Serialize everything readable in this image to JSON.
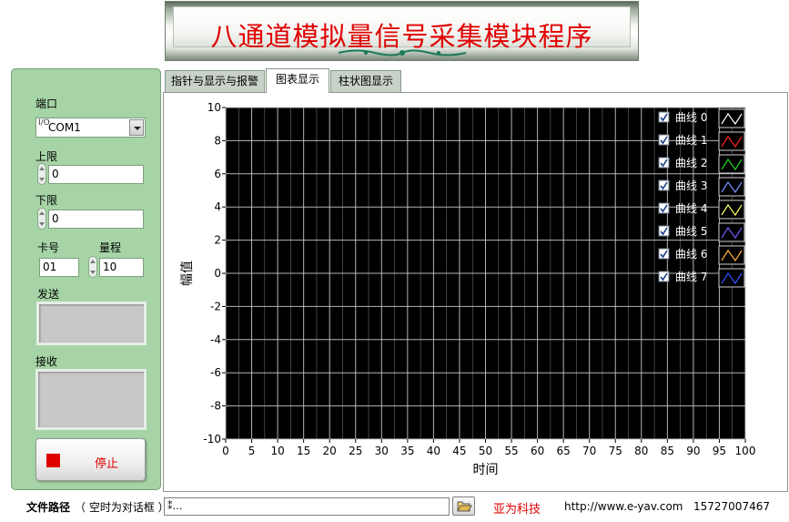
{
  "title": "八通道模拟量信号采集模块程序",
  "left_panel": {
    "port_label": "端口",
    "port_value": "COM1",
    "port_io_glyph": "I/O",
    "upper_label": "上限",
    "upper_value": "0",
    "lower_label": "下限",
    "lower_value": "0",
    "card_label": "卡号",
    "card_value": "01",
    "range_label": "量程",
    "range_value": "10",
    "send_label": "发送",
    "send_value": "",
    "receive_label": "接收",
    "receive_value": "",
    "stop_label": "停止"
  },
  "tabs": [
    {
      "label": "指针与显示与报警",
      "active": false
    },
    {
      "label": "图表显示",
      "active": true
    },
    {
      "label": "柱状图显示",
      "active": false
    }
  ],
  "chart_data": {
    "type": "line",
    "xlabel": "时间",
    "ylabel": "幅值",
    "xlim": [
      0,
      100
    ],
    "ylim": [
      -10,
      10
    ],
    "x_ticks": [
      0,
      5,
      10,
      15,
      20,
      25,
      30,
      35,
      40,
      45,
      50,
      55,
      60,
      65,
      70,
      75,
      80,
      85,
      90,
      95,
      100
    ],
    "y_ticks": [
      10,
      8,
      6,
      4,
      2,
      0,
      -2,
      -4,
      -6,
      -8,
      -10
    ],
    "grid": true,
    "minor_grid_x": true,
    "background": "#000000",
    "grid_color": "#c8c8c8",
    "legend_position": "top-right",
    "series": [
      {
        "name": "曲线 0",
        "color": "#ffffff",
        "checked": true,
        "values": []
      },
      {
        "name": "曲线 1",
        "color": "#ff2020",
        "checked": true,
        "values": []
      },
      {
        "name": "曲线 2",
        "color": "#20d020",
        "checked": true,
        "values": []
      },
      {
        "name": "曲线 3",
        "color": "#7090ff",
        "checked": true,
        "values": []
      },
      {
        "name": "曲线 4",
        "color": "#ffff60",
        "checked": true,
        "values": []
      },
      {
        "name": "曲线 5",
        "color": "#6a5cff",
        "checked": true,
        "values": []
      },
      {
        "name": "曲线 6",
        "color": "#ffb040",
        "checked": true,
        "values": []
      },
      {
        "name": "曲线 7",
        "color": "#3050ff",
        "checked": true,
        "values": []
      }
    ]
  },
  "bottom_bar": {
    "path_label": "文件路径",
    "path_hint": "（ 空时为对话框 ）",
    "path_value": "…",
    "path_glyph": "⁑",
    "company": "亚为科技",
    "url": "http://www.e-yav.com",
    "phone": "15727007467"
  },
  "colors": {
    "panel_green": "#a6d4a6",
    "accent_red": "#e00000"
  }
}
